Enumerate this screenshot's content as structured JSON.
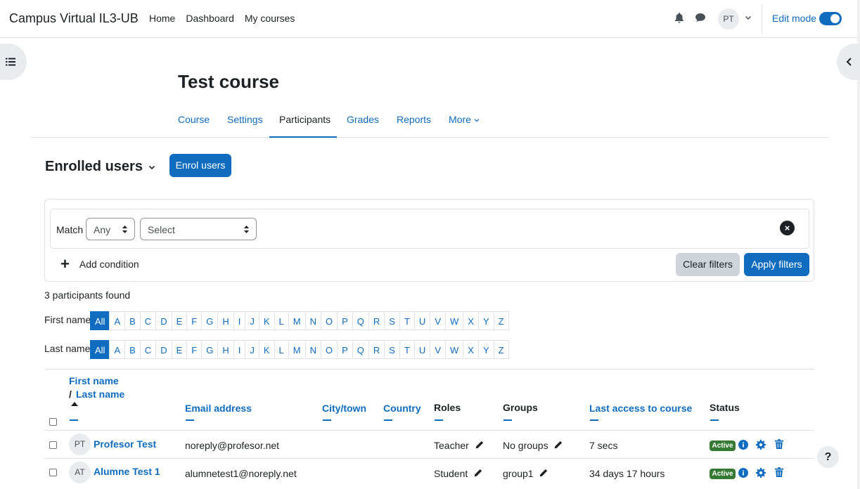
{
  "navbar": {
    "brand": "Campus Virtual IL3-UB",
    "links": [
      "Home",
      "Dashboard",
      "My courses"
    ],
    "user_initials": "PT",
    "edit_mode_label": "Edit mode",
    "edit_mode_on": true
  },
  "course": {
    "title": "Test course",
    "tabs": [
      "Course",
      "Settings",
      "Participants",
      "Grades",
      "Reports",
      "More"
    ],
    "active_tab": "Participants"
  },
  "participants": {
    "title": "Enrolled users",
    "enrol_button": "Enrol users",
    "filter": {
      "match_label": "Match",
      "match_value": "Any",
      "select_value": "Select",
      "add_condition": "Add condition",
      "clear_filters": "Clear filters",
      "apply_filters": "Apply filters"
    },
    "found_text": "3 participants found",
    "first_name_label": "First name",
    "last_name_label": "Last name",
    "initials": [
      "All",
      "A",
      "B",
      "C",
      "D",
      "E",
      "F",
      "G",
      "H",
      "I",
      "J",
      "K",
      "L",
      "M",
      "N",
      "O",
      "P",
      "Q",
      "R",
      "S",
      "T",
      "U",
      "V",
      "W",
      "X",
      "Y",
      "Z"
    ]
  },
  "table": {
    "headers": {
      "first_name": "First name",
      "slash": "/",
      "last_name": "Last name",
      "email": "Email address",
      "city": "City/town",
      "country": "Country",
      "roles": "Roles",
      "groups": "Groups",
      "last_access": "Last access to course",
      "status": "Status"
    },
    "rows": [
      {
        "initials": "PT",
        "name": "Profesor Test",
        "email": "noreply@profesor.net",
        "role": "Teacher",
        "groups": "No groups",
        "last_access": "7 secs",
        "status": "Active"
      },
      {
        "initials": "AT",
        "name": "Alumne Test 1",
        "email": "alumnetest1@noreply.net",
        "role": "Student",
        "groups": "group1",
        "last_access": "34 days 17 hours",
        "status": "Active"
      }
    ]
  },
  "help_label": "?"
}
